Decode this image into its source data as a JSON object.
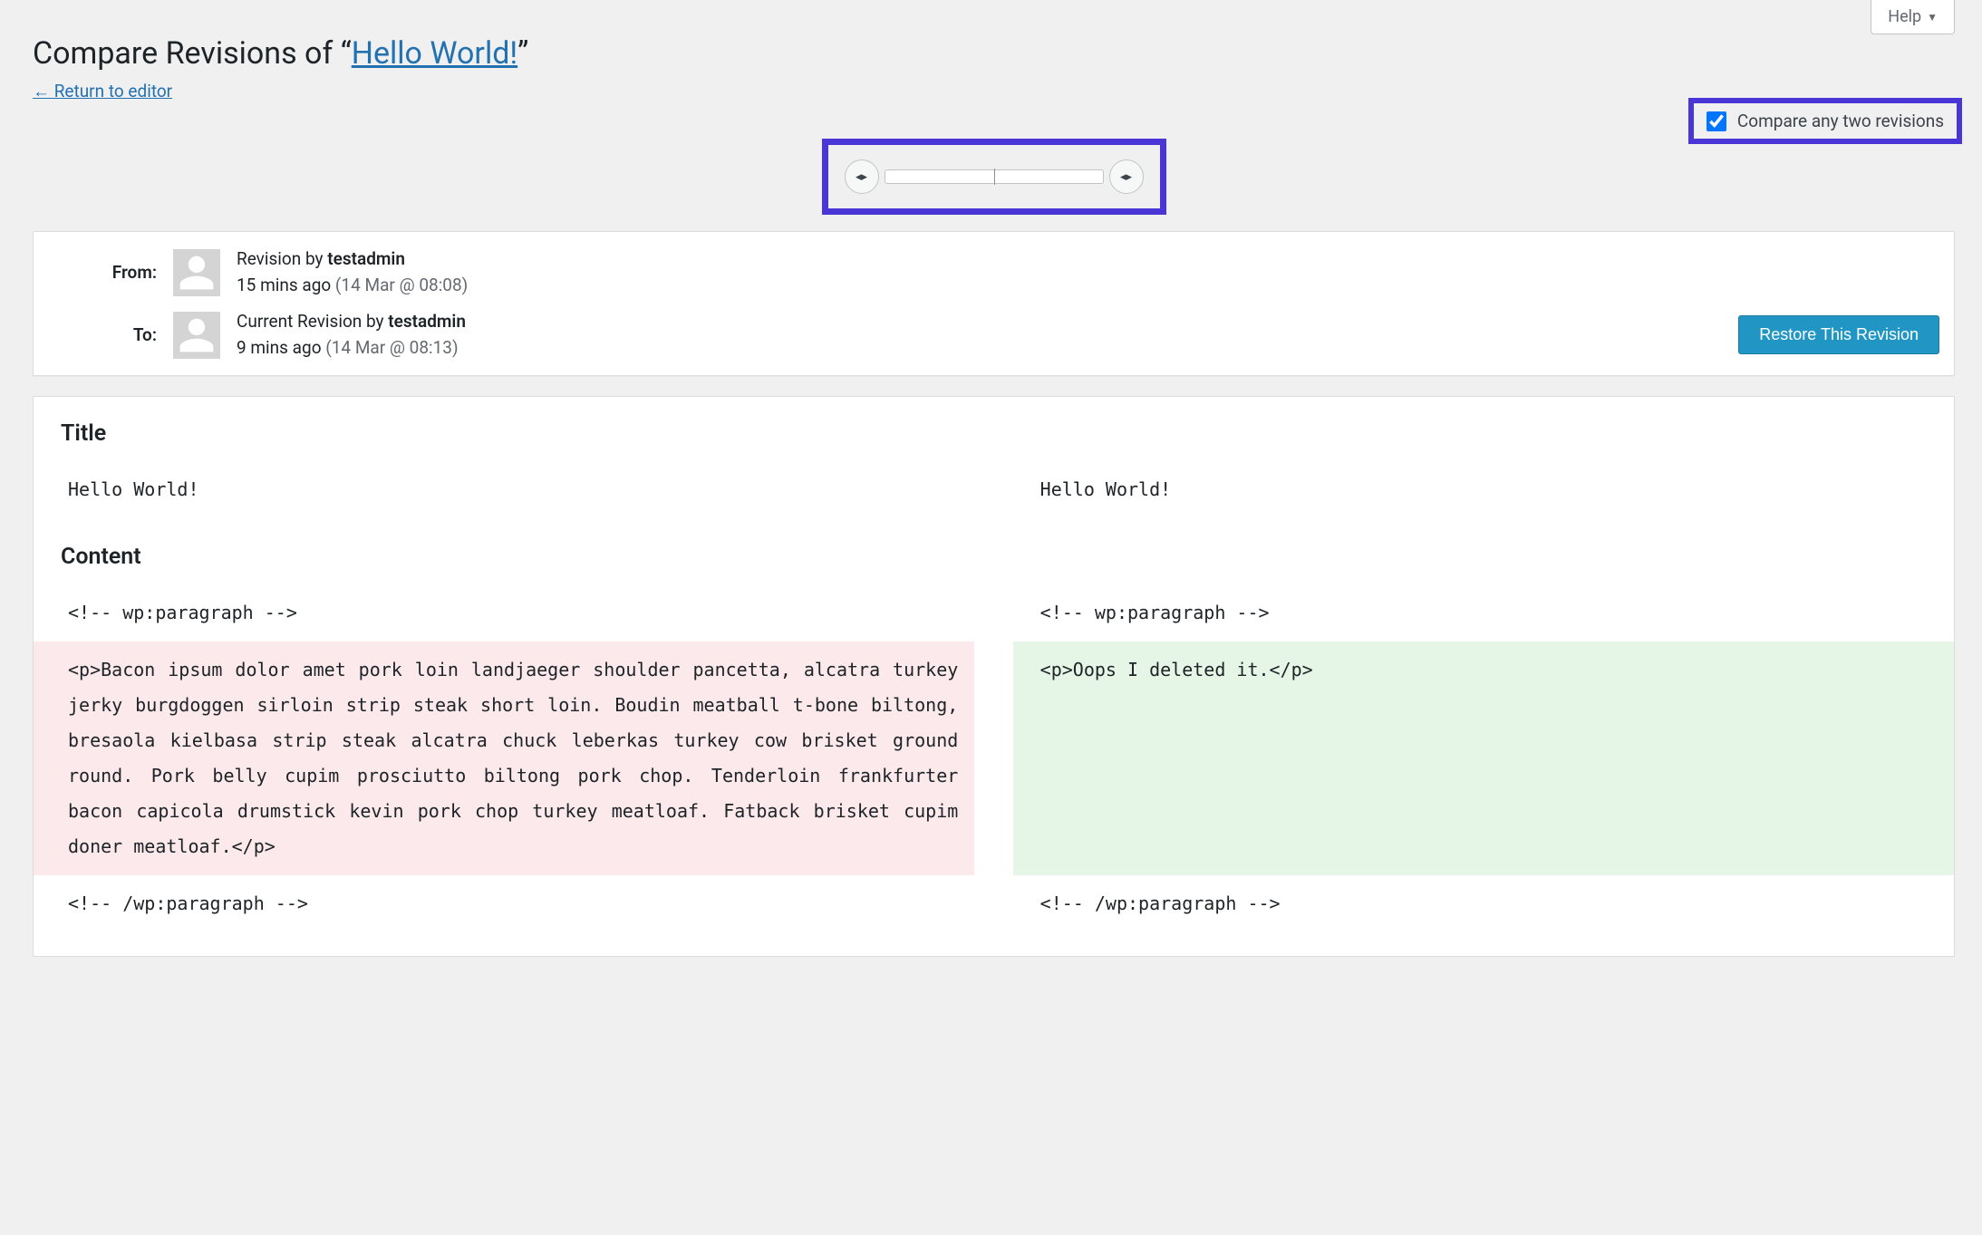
{
  "help": {
    "label": "Help"
  },
  "header": {
    "title_prefix": "Compare Revisions of “",
    "post_title": "Hello World!",
    "title_suffix": "”",
    "return_link": "← Return to editor"
  },
  "compare_toggle": {
    "label": "Compare any two revisions",
    "checked": true
  },
  "slider": {
    "prev_icon": "◂▸",
    "next_icon": "◂▸"
  },
  "from": {
    "label": "From:",
    "byline_prefix": "Revision by ",
    "author": "testadmin",
    "time_ago": "15 mins ago ",
    "timestamp": "(14 Mar @ 08:08)"
  },
  "to": {
    "label": "To:",
    "byline_prefix": "Current Revision by ",
    "author": "testadmin",
    "time_ago": "9 mins ago ",
    "timestamp": "(14 Mar @ 08:13)"
  },
  "restore_label": "Restore This Revision",
  "diff": {
    "title_heading": "Title",
    "title_left": "Hello World!",
    "title_right": "Hello World!",
    "content_heading": "Content",
    "rows": [
      {
        "left": "<!-- wp:paragraph -->",
        "right": "<!-- wp:paragraph -->",
        "type": "context"
      },
      {
        "left": "<p>Bacon ipsum dolor amet pork loin landjaeger shoulder pancetta, alcatra turkey jerky burgdoggen sirloin strip steak short loin. Boudin meatball t-bone biltong, bresaola kielbasa strip steak alcatra chuck leberkas turkey cow brisket ground round. Pork belly cupim prosciutto biltong pork chop. Tenderloin frankfurter bacon capicola drumstick kevin pork chop turkey meatloaf. Fatback brisket cupim doner meatloaf.</p>",
        "right": "<p>Oops I deleted it.</p>",
        "type": "change"
      },
      {
        "left": "<!-- /wp:paragraph -->",
        "right": "<!-- /wp:paragraph -->",
        "type": "context"
      }
    ]
  }
}
